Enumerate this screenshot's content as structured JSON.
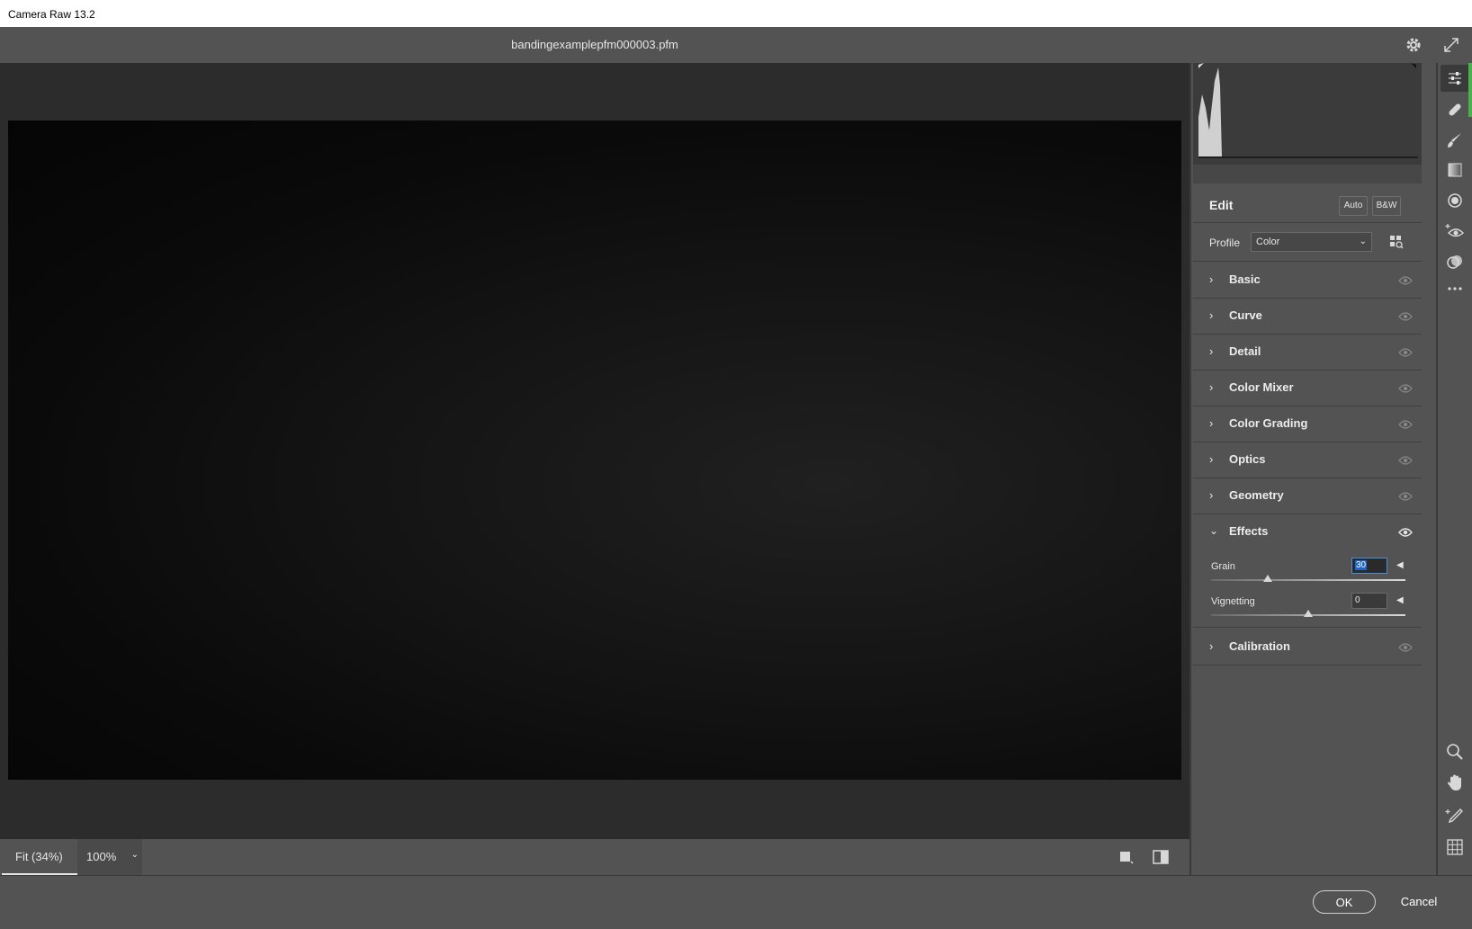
{
  "window": {
    "title": "Camera Raw 13.2"
  },
  "header": {
    "filename": "bandingexamplepfm000003.pfm"
  },
  "bottombar": {
    "fit_label": "Fit (34%)",
    "zoom_label": "100%"
  },
  "footer": {
    "ok_label": "OK",
    "cancel_label": "Cancel"
  },
  "panel": {
    "edit_title": "Edit",
    "auto_label": "Auto",
    "bw_label": "B&W",
    "profile_label": "Profile",
    "profile_value": "Color",
    "sections": [
      {
        "name": "Basic",
        "expanded": false
      },
      {
        "name": "Curve",
        "expanded": false
      },
      {
        "name": "Detail",
        "expanded": false
      },
      {
        "name": "Color Mixer",
        "expanded": false
      },
      {
        "name": "Color Grading",
        "expanded": false
      },
      {
        "name": "Optics",
        "expanded": false
      },
      {
        "name": "Geometry",
        "expanded": false
      },
      {
        "name": "Effects",
        "expanded": true
      },
      {
        "name": "Calibration",
        "expanded": false
      }
    ],
    "effects": {
      "grain_label": "Grain",
      "grain_value": "30",
      "vignetting_label": "Vignetting",
      "vignetting_value": "0"
    }
  },
  "tools": [
    "edit-sliders-icon",
    "healing-icon",
    "brush-icon",
    "linear-gradient-icon",
    "radial-gradient-icon",
    "red-eye-icon",
    "presets-icon",
    "more-icon",
    "zoom-icon",
    "hand-icon",
    "color-sampler-icon",
    "grid-icon"
  ],
  "colors": {
    "panel_bg": "#535353",
    "canvas_bg": "#2c2c2c",
    "accent_selection": "#1e66c8"
  }
}
